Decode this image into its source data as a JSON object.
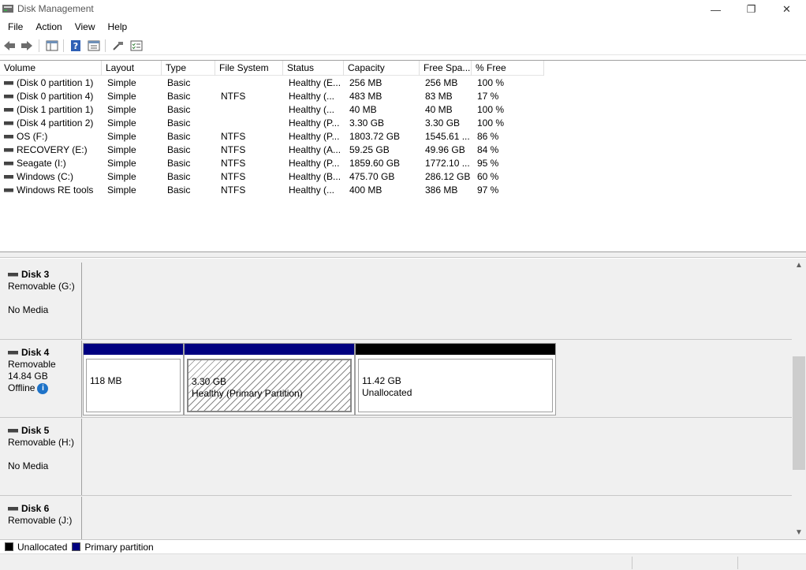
{
  "window": {
    "title": "Disk Management",
    "minimize_glyph": "—",
    "maximize_glyph": "❐",
    "close_glyph": "✕"
  },
  "menu": [
    "File",
    "Action",
    "View",
    "Help"
  ],
  "toolbar": {
    "icons": [
      "back-icon",
      "forward-icon",
      "show-hide-console-tree-icon",
      "help-icon",
      "properties-icon",
      "connect-disk-icon",
      "checklist-icon"
    ]
  },
  "volume_table": {
    "columns": [
      "Volume",
      "Layout",
      "Type",
      "File System",
      "Status",
      "Capacity",
      "Free Spa...",
      "% Free"
    ],
    "rows": [
      [
        "(Disk 0 partition 1)",
        "Simple",
        "Basic",
        "",
        "Healthy (E...",
        "256 MB",
        "256 MB",
        "100 %"
      ],
      [
        "(Disk 0 partition 4)",
        "Simple",
        "Basic",
        "NTFS",
        "Healthy (...",
        "483 MB",
        "83 MB",
        "17 %"
      ],
      [
        "(Disk 1 partition 1)",
        "Simple",
        "Basic",
        "",
        "Healthy (...",
        "40 MB",
        "40 MB",
        "100 %"
      ],
      [
        "(Disk 4 partition 2)",
        "Simple",
        "Basic",
        "",
        "Healthy (P...",
        "3.30 GB",
        "3.30 GB",
        "100 %"
      ],
      [
        "OS (F:)",
        "Simple",
        "Basic",
        "NTFS",
        "Healthy (P...",
        "1803.72 GB",
        "1545.61 ...",
        "86 %"
      ],
      [
        "RECOVERY (E:)",
        "Simple",
        "Basic",
        "NTFS",
        "Healthy (A...",
        "59.25 GB",
        "49.96 GB",
        "84 %"
      ],
      [
        "Seagate (I:)",
        "Simple",
        "Basic",
        "NTFS",
        "Healthy (P...",
        "1859.60 GB",
        "1772.10 ...",
        "95 %"
      ],
      [
        "Windows (C:)",
        "Simple",
        "Basic",
        "NTFS",
        "Healthy (B...",
        "475.70 GB",
        "286.12 GB",
        "60 %"
      ],
      [
        "Windows RE tools",
        "Simple",
        "Basic",
        "NTFS",
        "Healthy (...",
        "400 MB",
        "386 MB",
        "97 %"
      ]
    ]
  },
  "disks": [
    {
      "name": "Disk 3",
      "type": "Removable (G:)",
      "line2": "",
      "line3": "No Media"
    },
    {
      "name": "Disk 4",
      "type": "Removable",
      "line2": "14.84 GB",
      "line3": "Offline"
    },
    {
      "name": "Disk 5",
      "type": "Removable (H:)",
      "line2": "",
      "line3": "No Media"
    },
    {
      "name": "Disk 6",
      "type": "Removable (J:)",
      "line2": "",
      "line3": ""
    }
  ],
  "disk4_partitions": [
    {
      "size": "118 MB",
      "status": "",
      "bar_color": "#000080",
      "kind": "primary"
    },
    {
      "size": "3.30 GB",
      "status": "Healthy (Primary Partition)",
      "bar_color": "#000080",
      "kind": "primary-selected"
    },
    {
      "size": "11.42 GB",
      "status": "Unallocated",
      "bar_color": "#000000",
      "kind": "unallocated"
    }
  ],
  "info_glyph": "i",
  "legend": [
    {
      "label": "Unallocated",
      "color": "#000000"
    },
    {
      "label": "Primary partition",
      "color": "#000080"
    }
  ],
  "scrollbar": {
    "up_glyph": "▲",
    "down_glyph": "▼"
  }
}
